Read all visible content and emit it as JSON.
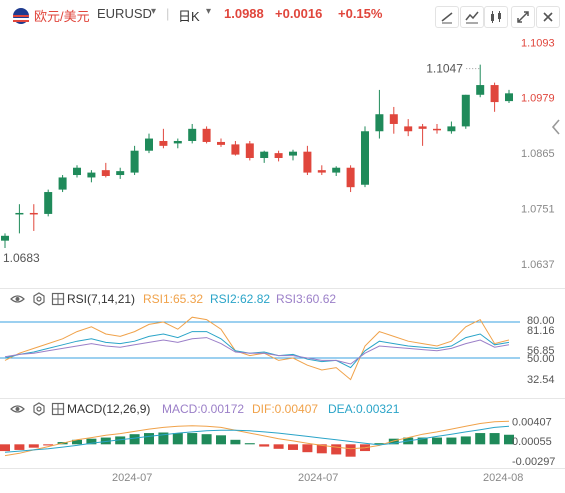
{
  "header": {
    "flag_icon": "us-flag-icon",
    "pair_name": "欧元/美元",
    "symbol": "EURUSD",
    "interval": "日K",
    "last_price": "1.0988",
    "change": "+0.0016",
    "change_pct": "+0.15%",
    "tools": [
      "draw-line-icon",
      "indicator-icon",
      "chart-type-icon",
      "expand-icon",
      "close-icon"
    ],
    "colors": {
      "up": "#e0463c",
      "down": "#1f8a5a",
      "pair": "#e0463c"
    }
  },
  "price_axis": {
    "ticks": [
      "1.1093",
      "1.0979",
      "1.0865",
      "1.0751",
      "1.0637"
    ],
    "tick_values": [
      1.1093,
      1.0979,
      1.0865,
      1.0751,
      1.0637
    ]
  },
  "annotations": {
    "high": "1.1047",
    "low": "1.0683"
  },
  "rsi": {
    "name": "RSI(7,14,21)",
    "rsi1_label": "RSI1:65.32",
    "rsi2_label": "RSI2:62.82",
    "rsi3_label": "RSI3:60.62",
    "ticks": [
      "80.00",
      "81.16",
      "56.85",
      "50.00",
      "32.54"
    ],
    "tick_values": [
      80,
      81.16,
      56.85,
      50,
      32.54
    ],
    "colors": {
      "rsi1": "#f0a24a",
      "rsi2": "#2aa4c8",
      "rsi3": "#9b7fc8",
      "band": "#3aa0e0"
    }
  },
  "macd": {
    "name": "MACD(12,26,9)",
    "macd_label": "MACD:0.00172",
    "dif_label": "DIF:0.00407",
    "dea_label": "DEA:0.00321",
    "ticks": [
      "0.00407",
      "0.00055",
      "-0.00297"
    ],
    "tick_values": [
      0.00407,
      0.00055,
      -0.00297
    ],
    "colors": {
      "macd": "#9b7fc8",
      "dif": "#f0a24a",
      "dea": "#2aa4c8"
    }
  },
  "time_axis": {
    "labels": [
      "2024-07",
      "2024-07",
      "2024-08"
    ]
  },
  "chart_data": {
    "type": "candlestick",
    "symbol": "EURUSD",
    "interval": "日K",
    "ylim": [
      1.06,
      1.111
    ],
    "candles": [
      {
        "o": 1.0685,
        "h": 1.07,
        "l": 1.067,
        "c": 1.0695
      },
      {
        "o": 1.074,
        "h": 1.076,
        "l": 1.07,
        "c": 1.0742
      },
      {
        "o": 1.0742,
        "h": 1.076,
        "l": 1.0705,
        "c": 1.074
      },
      {
        "o": 1.074,
        "h": 1.079,
        "l": 1.0735,
        "c": 1.0785
      },
      {
        "o": 1.079,
        "h": 1.082,
        "l": 1.0785,
        "c": 1.0815
      },
      {
        "o": 1.082,
        "h": 1.084,
        "l": 1.0815,
        "c": 1.0835
      },
      {
        "o": 1.0815,
        "h": 1.083,
        "l": 1.0805,
        "c": 1.0825
      },
      {
        "o": 1.083,
        "h": 1.0845,
        "l": 1.0815,
        "c": 1.0818
      },
      {
        "o": 1.082,
        "h": 1.0835,
        "l": 1.0812,
        "c": 1.0828
      },
      {
        "o": 1.0825,
        "h": 1.088,
        "l": 1.082,
        "c": 1.087
      },
      {
        "o": 1.087,
        "h": 1.0905,
        "l": 1.0865,
        "c": 1.0895
      },
      {
        "o": 1.089,
        "h": 1.0915,
        "l": 1.0875,
        "c": 1.088
      },
      {
        "o": 1.0885,
        "h": 1.0895,
        "l": 1.0875,
        "c": 1.089
      },
      {
        "o": 1.089,
        "h": 1.0925,
        "l": 1.0885,
        "c": 1.0915
      },
      {
        "o": 1.0915,
        "h": 1.092,
        "l": 1.0885,
        "c": 1.0888
      },
      {
        "o": 1.0888,
        "h": 1.0895,
        "l": 1.0878,
        "c": 1.0882
      },
      {
        "o": 1.0883,
        "h": 1.089,
        "l": 1.086,
        "c": 1.0862
      },
      {
        "o": 1.0885,
        "h": 1.089,
        "l": 1.085,
        "c": 1.0855
      },
      {
        "o": 1.0855,
        "h": 1.087,
        "l": 1.0845,
        "c": 1.0868
      },
      {
        "o": 1.0865,
        "h": 1.087,
        "l": 1.0848,
        "c": 1.0855
      },
      {
        "o": 1.086,
        "h": 1.0872,
        "l": 1.085,
        "c": 1.0868
      },
      {
        "o": 1.0868,
        "h": 1.088,
        "l": 1.082,
        "c": 1.0825
      },
      {
        "o": 1.083,
        "h": 1.084,
        "l": 1.082,
        "c": 1.0825
      },
      {
        "o": 1.0825,
        "h": 1.0838,
        "l": 1.0818,
        "c": 1.0835
      },
      {
        "o": 1.0835,
        "h": 1.084,
        "l": 1.0785,
        "c": 1.0795
      },
      {
        "o": 1.08,
        "h": 1.092,
        "l": 1.0795,
        "c": 1.091
      },
      {
        "o": 1.091,
        "h": 1.0995,
        "l": 1.0895,
        "c": 1.0945
      },
      {
        "o": 1.0945,
        "h": 1.096,
        "l": 1.0905,
        "c": 1.0925
      },
      {
        "o": 1.092,
        "h": 1.0935,
        "l": 1.09,
        "c": 1.091
      },
      {
        "o": 1.092,
        "h": 1.0925,
        "l": 1.088,
        "c": 1.0915
      },
      {
        "o": 1.0915,
        "h": 1.0925,
        "l": 1.0905,
        "c": 1.0912
      },
      {
        "o": 1.091,
        "h": 1.093,
        "l": 1.0905,
        "c": 1.092
      },
      {
        "o": 1.092,
        "h": 1.0985,
        "l": 1.0915,
        "c": 1.0985
      },
      {
        "o": 1.0985,
        "h": 1.1047,
        "l": 1.098,
        "c": 1.1005
      },
      {
        "o": 1.1005,
        "h": 1.101,
        "l": 1.095,
        "c": 1.097
      },
      {
        "o": 1.0972,
        "h": 1.0995,
        "l": 1.0968,
        "c": 1.0988
      }
    ],
    "rsi1": [
      48,
      54,
      58,
      62,
      66,
      72,
      76,
      70,
      68,
      72,
      78,
      80,
      74,
      84,
      82,
      74,
      56,
      52,
      54,
      48,
      50,
      44,
      40,
      42,
      32,
      60,
      72,
      68,
      64,
      62,
      60,
      64,
      76,
      82,
      62,
      65
    ],
    "rsi2": [
      50,
      53,
      55,
      58,
      61,
      64,
      66,
      63,
      62,
      64,
      68,
      70,
      67,
      72,
      72,
      66,
      56,
      54,
      55,
      52,
      53,
      49,
      47,
      48,
      42,
      56,
      64,
      62,
      60,
      59,
      58,
      60,
      67,
      70,
      61,
      63
    ],
    "rsi3": [
      51,
      53,
      54,
      56,
      58,
      60,
      62,
      60,
      59,
      61,
      63,
      65,
      63,
      66,
      67,
      62,
      55,
      54,
      54,
      52,
      52,
      50,
      48,
      48,
      45,
      54,
      60,
      59,
      58,
      57,
      56,
      58,
      62,
      65,
      59,
      61
    ],
    "macd_hist": [
      -0.0012,
      -0.001,
      -0.0006,
      -0.0002,
      0.0004,
      0.0008,
      0.001,
      0.0012,
      0.0014,
      0.0018,
      0.002,
      0.0021,
      0.002,
      0.002,
      0.0018,
      0.0016,
      0.0008,
      0.0002,
      -0.0004,
      -0.0008,
      -0.001,
      -0.0014,
      -0.0016,
      -0.0018,
      -0.0022,
      -0.0012,
      0.0002,
      0.001,
      0.0012,
      0.0012,
      0.0012,
      0.0012,
      0.0014,
      0.002,
      0.002,
      0.0017
    ],
    "dif": [
      -0.002,
      -0.0016,
      -0.001,
      -0.0004,
      0.0002,
      0.0008,
      0.0012,
      0.0016,
      0.0019,
      0.0023,
      0.0027,
      0.003,
      0.0032,
      0.0033,
      0.0032,
      0.003,
      0.0025,
      0.002,
      0.0015,
      0.001,
      0.0006,
      0.0002,
      -0.0002,
      -0.0005,
      -0.0008,
      -0.0006,
      -0.0002,
      0.0006,
      0.0012,
      0.0018,
      0.0022,
      0.0027,
      0.0032,
      0.0037,
      0.004,
      0.0041
    ],
    "dea": [
      -0.0014,
      -0.0012,
      -0.001,
      -0.0008,
      -0.0005,
      -0.0002,
      0.0002,
      0.0005,
      0.0008,
      0.0011,
      0.0014,
      0.0017,
      0.002,
      0.0022,
      0.0024,
      0.0025,
      0.0025,
      0.0024,
      0.0022,
      0.002,
      0.0017,
      0.0014,
      0.0011,
      0.0008,
      0.0005,
      0.0002,
      -0.0001,
      0.0002,
      0.0006,
      0.001,
      0.0014,
      0.0018,
      0.0022,
      0.0026,
      0.003,
      0.0032
    ]
  }
}
